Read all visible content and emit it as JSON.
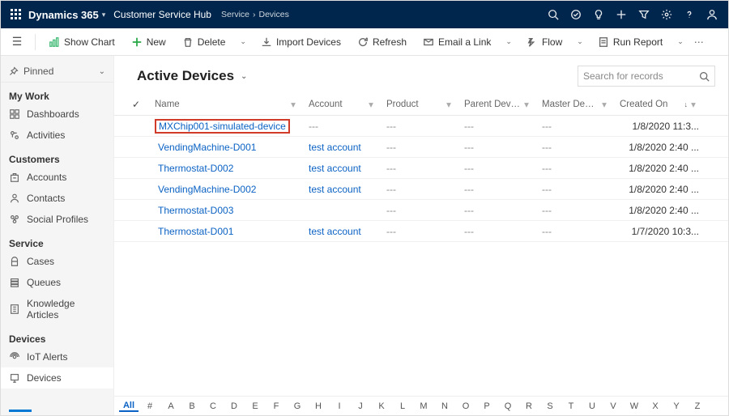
{
  "top": {
    "brand": "Dynamics 365",
    "hub": "Customer Service Hub",
    "crumb1": "Service",
    "crumb2": "Devices"
  },
  "cmd": {
    "showChart": "Show Chart",
    "new": "New",
    "delete": "Delete",
    "import": "Import Devices",
    "refresh": "Refresh",
    "email": "Email a Link",
    "flow": "Flow",
    "run": "Run Report"
  },
  "sidebar": {
    "pinned": "Pinned",
    "groups": [
      {
        "label": "My Work",
        "items": [
          {
            "icon": "dash",
            "label": "Dashboards"
          },
          {
            "icon": "act",
            "label": "Activities"
          }
        ]
      },
      {
        "label": "Customers",
        "items": [
          {
            "icon": "acc",
            "label": "Accounts"
          },
          {
            "icon": "con",
            "label": "Contacts"
          },
          {
            "icon": "soc",
            "label": "Social Profiles"
          }
        ]
      },
      {
        "label": "Service",
        "items": [
          {
            "icon": "case",
            "label": "Cases"
          },
          {
            "icon": "que",
            "label": "Queues"
          },
          {
            "icon": "kb",
            "label": "Knowledge Articles"
          }
        ]
      },
      {
        "label": "Devices",
        "items": [
          {
            "icon": "iot",
            "label": "IoT Alerts"
          },
          {
            "icon": "dev",
            "label": "Devices",
            "active": true
          }
        ]
      }
    ]
  },
  "view": {
    "title": "Active Devices",
    "searchPlaceholder": "Search for records"
  },
  "columns": {
    "name": "Name",
    "account": "Account",
    "product": "Product",
    "parent": "Parent Device",
    "master": "Master Device",
    "created": "Created On"
  },
  "rows": [
    {
      "name": "MXChip001-simulated-device",
      "account": "---",
      "product": "---",
      "parent": "---",
      "master": "---",
      "created": "1/8/2020 11:3...",
      "hl": true
    },
    {
      "name": "VendingMachine-D001",
      "account": "test account",
      "product": "---",
      "parent": "---",
      "master": "---",
      "created": "1/8/2020 2:40 ..."
    },
    {
      "name": "Thermostat-D002",
      "account": "test account",
      "product": "---",
      "parent": "---",
      "master": "---",
      "created": "1/8/2020 2:40 ..."
    },
    {
      "name": "VendingMachine-D002",
      "account": "test account",
      "product": "---",
      "parent": "---",
      "master": "---",
      "created": "1/8/2020 2:40 ..."
    },
    {
      "name": "Thermostat-D003",
      "account": "",
      "product": "---",
      "parent": "---",
      "master": "---",
      "created": "1/8/2020 2:40 ..."
    },
    {
      "name": "Thermostat-D001",
      "account": "test account",
      "product": "---",
      "parent": "---",
      "master": "---",
      "created": "1/7/2020 10:3..."
    }
  ],
  "alpha": [
    "All",
    "#",
    "A",
    "B",
    "C",
    "D",
    "E",
    "F",
    "G",
    "H",
    "I",
    "J",
    "K",
    "L",
    "M",
    "N",
    "O",
    "P",
    "Q",
    "R",
    "S",
    "T",
    "U",
    "V",
    "W",
    "X",
    "Y",
    "Z"
  ]
}
